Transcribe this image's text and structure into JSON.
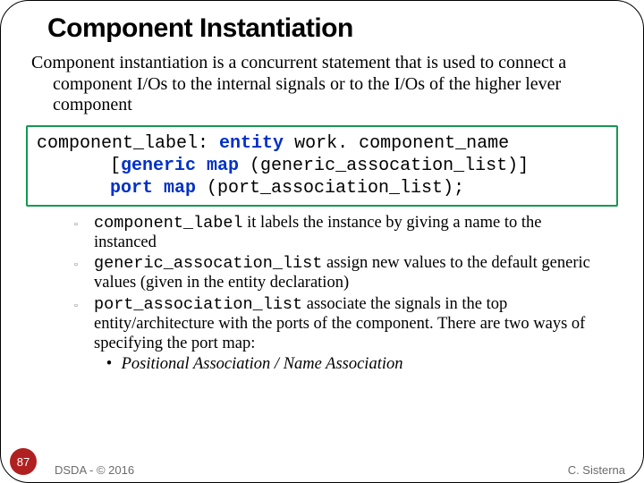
{
  "title": "Component Instantiation",
  "lead": "Component instantiation is a concurrent statement that is used to connect a component I/Os to the internal signals or to the I/Os of the higher lever component",
  "code": {
    "l1a": "component_label: ",
    "l1_kw": "entity",
    "l1b": " work. component_name",
    "l2a": "[",
    "l2_kw": "generic map",
    "l2b": " (generic_assocation_list)]",
    "l3_kw": "port map",
    "l3b": " (port_association_list);"
  },
  "bullets": [
    {
      "code": "component_label",
      "rest": " it labels the instance by giving a name to the instanced"
    },
    {
      "code": "generic_assocation_list",
      "rest": " assign new values to the default generic values (given in the entity declaration)"
    },
    {
      "code": "port_association_list",
      "rest": " associate the signals in the top entity/architecture with the ports of the component. There are two ways of specifying the port map:"
    }
  ],
  "subbullet": "Positional Association  / Name Association",
  "page": "87",
  "footer_left": "DSDA - © 2016",
  "footer_right": "C. Sisterna"
}
